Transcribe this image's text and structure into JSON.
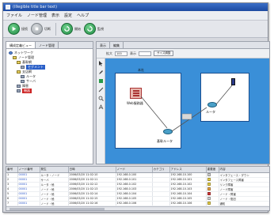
{
  "window": {
    "title": "(illegible title bar text)"
  },
  "menubar": {
    "items": [
      "ファイル",
      "ノード管理",
      "表示",
      "設定",
      "ヘルプ"
    ]
  },
  "toolbar": {
    "buttons": [
      {
        "label": "接続",
        "icon": "play-icon"
      },
      {
        "label": "切断",
        "icon": "stop-icon"
      },
      {
        "label": "開始",
        "icon": "refresh-icon"
      },
      {
        "label": "監視",
        "icon": "refresh-icon"
      }
    ]
  },
  "left_pane": {
    "tabs": [
      "構成定義ビュー",
      "ノード管理"
    ],
    "tree": [
      {
        "label": "ネットワーク",
        "icon": "network-icon",
        "indent": 0,
        "highlight": ""
      },
      {
        "label": "ノード管理",
        "icon": "folder-icon",
        "indent": 1,
        "highlight": ""
      },
      {
        "label": "基幹網",
        "icon": "folder-icon",
        "indent": 2,
        "highlight": ""
      },
      {
        "label": "セグメント",
        "icon": "device-icon",
        "indent": 3,
        "highlight": "blue"
      },
      {
        "label": "支店網",
        "icon": "folder-icon",
        "indent": 2,
        "highlight": ""
      },
      {
        "label": "ルータ",
        "icon": "device-icon",
        "indent": 3,
        "highlight": ""
      },
      {
        "label": "サーバ",
        "icon": "device-icon",
        "indent": 3,
        "highlight": ""
      },
      {
        "label": "障害",
        "icon": "device-icon",
        "indent": 2,
        "highlight": ""
      },
      {
        "label": "機器",
        "icon": "device-icon",
        "indent": 2,
        "highlight": "red"
      }
    ]
  },
  "map_pane": {
    "tabs": [
      "表示",
      "編集"
    ],
    "toolbar": {
      "field1_label": "拡大",
      "field1_value": "100",
      "field2_label": "表示",
      "field2_value": "",
      "action_label": "サイズ調整"
    },
    "tools": [
      "select-tool-icon",
      "pen-tool-icon",
      "node-tool-icon",
      "link-tool-icon",
      "zoom-tool-icon",
      "text-tool-icon"
    ],
    "node_a_title": "本社",
    "node_a_server_label": "Web服務器",
    "node_a_router_label": "基幹ルータ",
    "node_b_router_label": "ルータ",
    "link_label": "",
    "ref_a": "",
    "ref_b": ""
  },
  "events": {
    "columns": [
      "番号",
      "ノード番号",
      "発生",
      "日時",
      "ノード",
      "カテゴリ",
      "アドレス",
      "重要度",
      "内容"
    ],
    "rows": [
      {
        "no": "1",
        "node": "00001",
        "cat": "ルータ・ノード",
        "time": "2006/03/20 11:02:10",
        "host": "192.168.0.100",
        "addr": "192.168.10.100",
        "sev_color": "#d4d4d4",
        "sev_label": "",
        "msg": "インタフェース・ダウン"
      },
      {
        "no": "2",
        "node": "00001",
        "cat": "サーバ",
        "time": "2006/03/20 11:02:11",
        "host": "192.168.0.101",
        "addr": "192.168.10.101",
        "sev_color": "#e8d14a",
        "sev_label": "",
        "msg": "インタフェース障害"
      },
      {
        "no": "3",
        "node": "00001",
        "cat": "ルータ・他",
        "time": "2006/03/20 11:02:12",
        "host": "192.168.0.102",
        "addr": "192.168.10.102",
        "sev_color": "#e8d14a",
        "sev_label": "",
        "msg": "リンク障害"
      },
      {
        "no": "4",
        "node": "00001",
        "cat": "ノード・他",
        "time": "2006/03/20 11:02:13",
        "host": "192.168.0.103",
        "addr": "192.168.10.103",
        "sev_color": "#e8a84a",
        "sev_label": "",
        "msg": "ノード障害"
      },
      {
        "no": "5",
        "node": "00001",
        "cat": "ノード・他",
        "time": "2006/03/20 11:02:14",
        "host": "192.168.0.104",
        "addr": "192.168.10.104",
        "sev_color": "#d43a3a",
        "sev_label": "",
        "msg": "ノード・障害"
      },
      {
        "no": "6",
        "node": "00001",
        "cat": "ノード・他",
        "time": "2006/03/20 11:02:15",
        "host": "192.168.0.105",
        "addr": "192.168.10.105",
        "sev_color": "#d4d4d4",
        "sev_label": "",
        "msg": "ノード・復旧"
      },
      {
        "no": "7",
        "node": "00001",
        "cat": "ノード・他",
        "time": "2006/03/20 11:02:16",
        "host": "192.168.0.106",
        "addr": "192.168.10.106",
        "sev_color": "#e8d14a",
        "sev_label": "",
        "msg": "通知"
      }
    ]
  },
  "colors": {
    "canvas_bg": "#3a8fd8",
    "accent": "#2a5fc8",
    "alert": "#cc2222"
  }
}
